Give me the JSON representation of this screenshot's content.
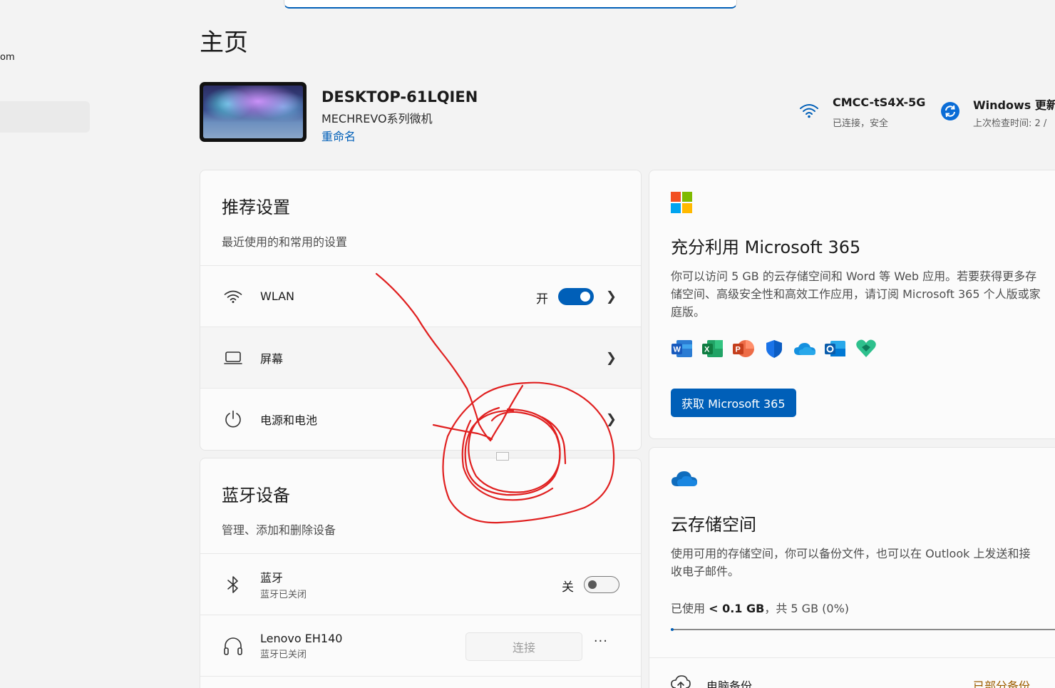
{
  "left_nav": {
    "account_fragment": "om"
  },
  "page": {
    "title": "主页"
  },
  "device": {
    "name": "DESKTOP-61LQIEN",
    "model": "MECHREVO系列微机",
    "rename_label": "重命名"
  },
  "status": {
    "wifi": {
      "title": "CMCC-tS4X-5G",
      "sub": "已连接，安全"
    },
    "update": {
      "title": "Windows 更新",
      "sub": "上次检查时间: 2 /"
    }
  },
  "recommended": {
    "title": "推荐设置",
    "subtitle": "最近使用的和常用的设置",
    "items": [
      {
        "label": "WLAN",
        "state_label": "开"
      },
      {
        "label": "屏幕"
      },
      {
        "label": "电源和电池"
      }
    ]
  },
  "bluetooth": {
    "title": "蓝牙设备",
    "subtitle": "管理、添加和删除设备",
    "items": [
      {
        "label": "蓝牙",
        "sub": "蓝牙已关闭",
        "state_label": "关"
      },
      {
        "label": "Lenovo EH140",
        "sub": "蓝牙已关闭",
        "action_label": "连接",
        "more": "···"
      }
    ]
  },
  "ms365": {
    "title": "充分利用 Microsoft 365",
    "desc_lines": [
      "你可以访问 5 GB 的云存储空间和 Word 等 Web 应用。若要获得更多存",
      "储空间、高级安全性和高效工作应用，请订阅 Microsoft 365 个人版或家",
      "庭版。"
    ],
    "apps": [
      "word-icon",
      "excel-icon",
      "powerpoint-icon",
      "defender-icon",
      "onedrive-icon",
      "outlook-icon",
      "family-safety-icon"
    ],
    "button_label": "获取 Microsoft 365"
  },
  "cloud": {
    "title": "云存储空间",
    "desc_lines": [
      "使用可用的存储空间，你可以备份文件，也可以在 Outlook 上发送和接",
      "收电子邮件。"
    ],
    "usage_prefix": "已使用",
    "usage_value": "< 0.1 GB",
    "usage_suffix": "，共 5 GB (0%)",
    "usage_percent": 0,
    "backup_label": "电脑备份",
    "backup_status": "已部分备份"
  },
  "colors": {
    "accent": "#005fb8",
    "annotation": "#e02020"
  }
}
